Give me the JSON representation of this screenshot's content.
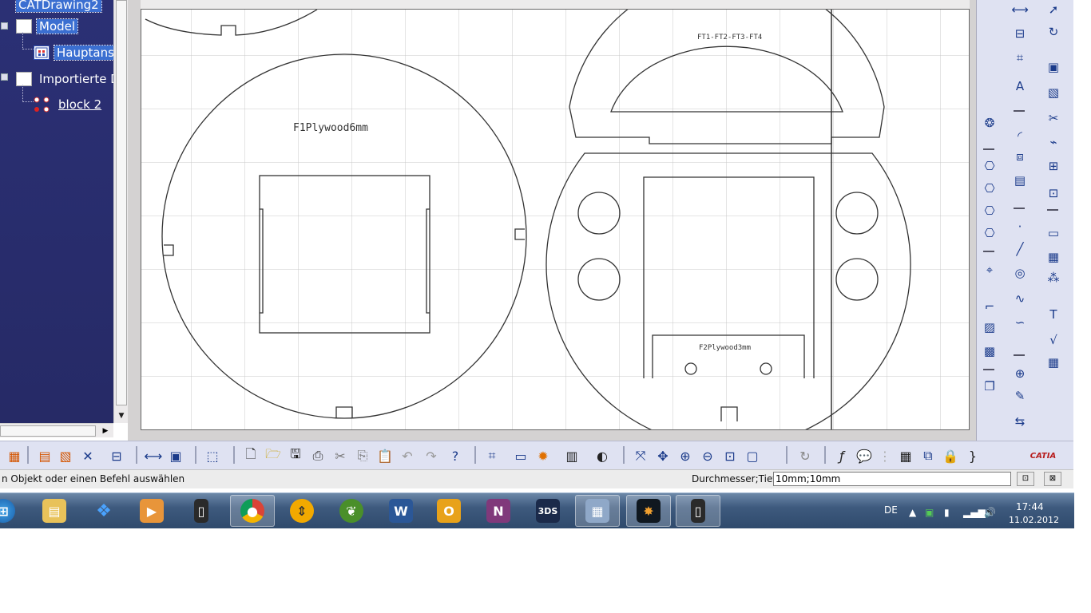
{
  "tree": {
    "nodes": [
      {
        "label": "CATDrawing2"
      },
      {
        "label": "Model"
      },
      {
        "label": "Hauptans"
      },
      {
        "label": "Importierte D"
      },
      {
        "label": "block 2"
      }
    ]
  },
  "drawing": {
    "label_f1": "F1Plywood6mm",
    "label_ft": "FT1-FT2-FT3-FT4",
    "label_f2": "F2Plywood3mm"
  },
  "statusbar": {
    "message": "n Objekt oder einen Befehl auswählen",
    "prompt": "Durchmesser;Tiefe",
    "input_value": "10mm;10mm"
  },
  "taskbar": {
    "apps": [
      "start",
      "explorer",
      "dropbox",
      "media-player",
      "phone-app",
      "chrome",
      "transfer",
      "garden",
      "word",
      "outlook",
      "onenote",
      "catia-launcher",
      "calculator",
      "catia",
      "phone-sync"
    ],
    "tray_lang": "DE",
    "time": "17:44",
    "date": "11.02.2012"
  },
  "colors": {
    "tree_bg": "#2a2f6e",
    "selection": "#3b6fd1",
    "toolbar_bg": "#dfe2f2",
    "taskbar_bg": "#3e5a7e"
  },
  "icons": {
    "catia_logo": "CATIA"
  }
}
